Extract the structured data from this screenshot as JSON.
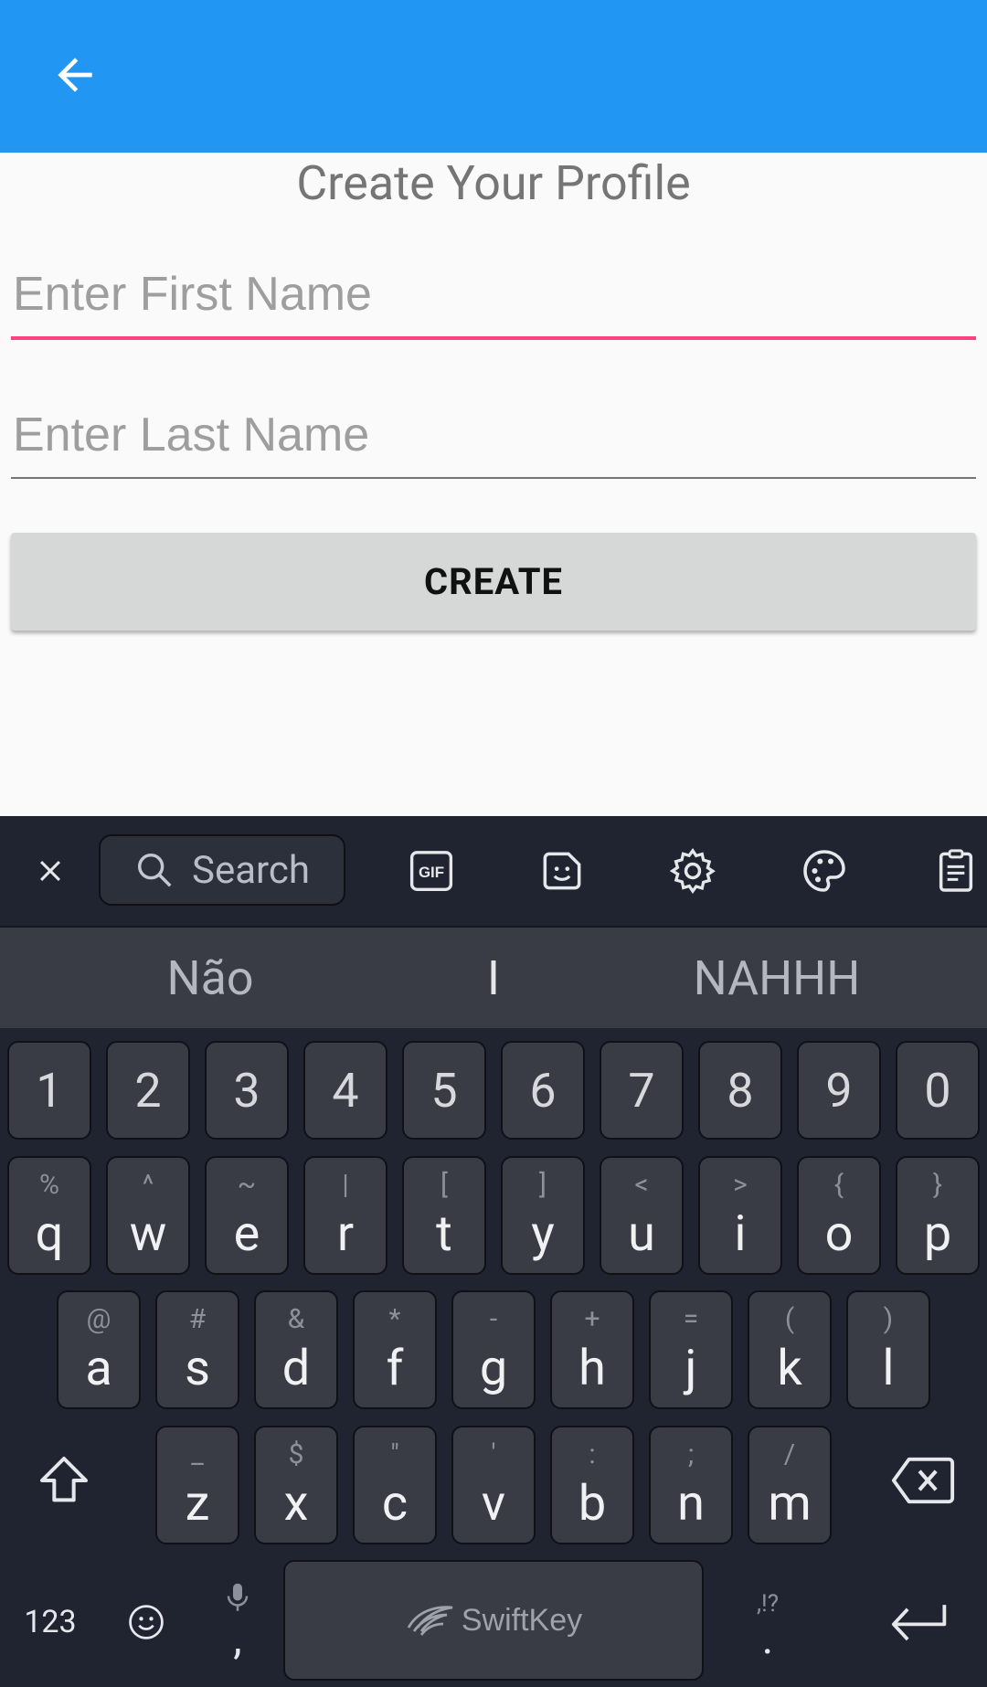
{
  "app": {
    "title": "Create Your Profile",
    "first_name_placeholder": "Enter First Name",
    "last_name_placeholder": "Enter Last Name",
    "create_label": "CREATE",
    "colors": {
      "appbar": "#2196F3",
      "focus_underline": "#ff4081"
    }
  },
  "keyboard": {
    "search_label": "Search",
    "suggestions": [
      "Não",
      "I",
      "NAHHH"
    ],
    "numbers": [
      "1",
      "2",
      "3",
      "4",
      "5",
      "6",
      "7",
      "8",
      "9",
      "0"
    ],
    "row1": [
      {
        "k": "q",
        "alt": "%"
      },
      {
        "k": "w",
        "alt": "^"
      },
      {
        "k": "e",
        "alt": "~"
      },
      {
        "k": "r",
        "alt": "|"
      },
      {
        "k": "t",
        "alt": "["
      },
      {
        "k": "y",
        "alt": "]"
      },
      {
        "k": "u",
        "alt": "<"
      },
      {
        "k": "i",
        "alt": ">"
      },
      {
        "k": "o",
        "alt": "{"
      },
      {
        "k": "p",
        "alt": "}"
      }
    ],
    "row2": [
      {
        "k": "a",
        "alt": "@"
      },
      {
        "k": "s",
        "alt": "#"
      },
      {
        "k": "d",
        "alt": "&"
      },
      {
        "k": "f",
        "alt": "*"
      },
      {
        "k": "g",
        "alt": "-"
      },
      {
        "k": "h",
        "alt": "+"
      },
      {
        "k": "j",
        "alt": "="
      },
      {
        "k": "k",
        "alt": "("
      },
      {
        "k": "l",
        "alt": ")"
      }
    ],
    "row3": [
      {
        "k": "z",
        "alt": "_"
      },
      {
        "k": "x",
        "alt": "$"
      },
      {
        "k": "c",
        "alt": "\""
      },
      {
        "k": "v",
        "alt": "'"
      },
      {
        "k": "b",
        "alt": ":"
      },
      {
        "k": "n",
        "alt": ";"
      },
      {
        "k": "m",
        "alt": "/"
      }
    ],
    "numbers_mode_label": "123",
    "comma_label": ",",
    "period_label": ".",
    "punct_hint": ",!?",
    "spacebar_label": "SwiftKey",
    "icons": [
      "close-icon",
      "search-icon",
      "gif-icon",
      "sticker-icon",
      "settings-icon",
      "palette-icon",
      "clipboard-icon",
      "shift-icon",
      "backspace-icon",
      "emoji-icon",
      "mic-icon",
      "enter-icon"
    ]
  }
}
